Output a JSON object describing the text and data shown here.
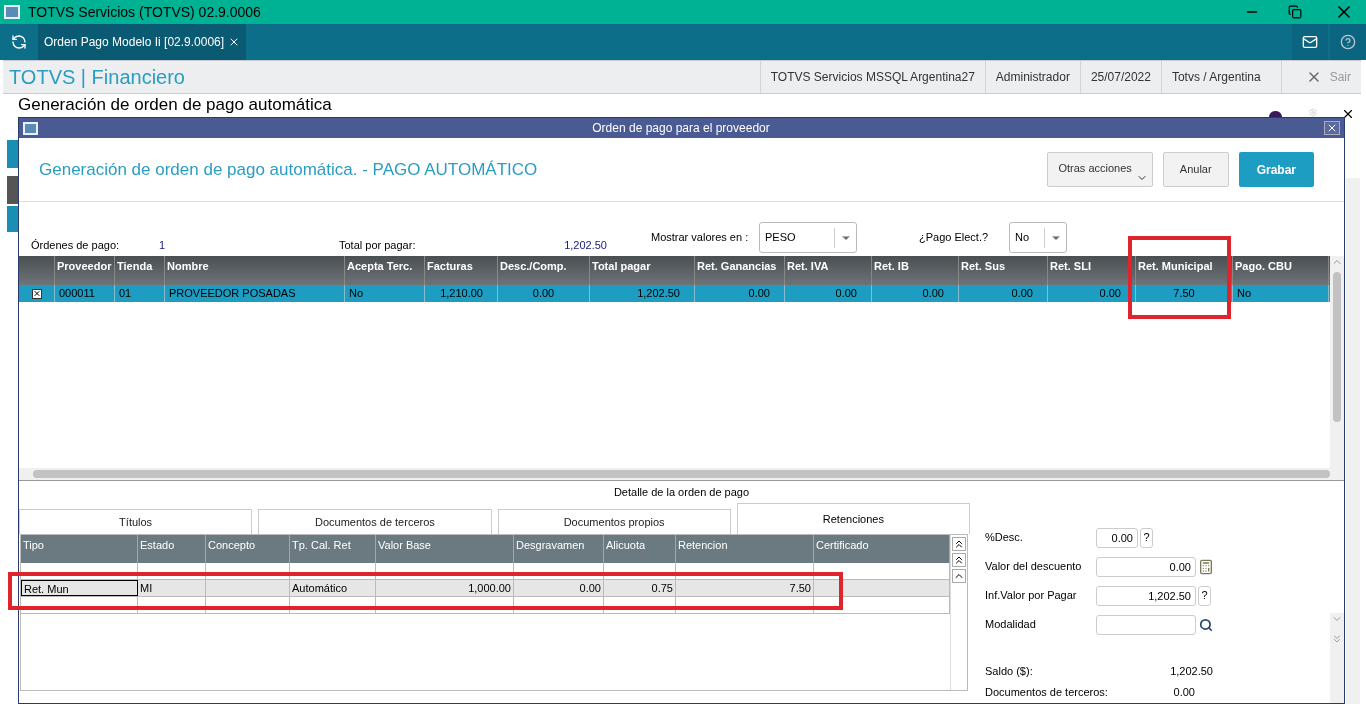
{
  "window": {
    "title": "TOTVS Servicios (TOTVS) 02.9.0006"
  },
  "app_tab": {
    "label": "Orden Pago Modelo Ii [02.9.0006]"
  },
  "header": {
    "title": "TOTVS | Financiero",
    "info": [
      "TOTVS Servicios MSSQL Argentina27",
      "Administrador",
      "25/07/2022",
      "Totvs / Argentina"
    ],
    "exit": "Sair"
  },
  "page_title": "Generación de orden de pago automática",
  "dialog": {
    "title": "Orden de pago para el proveedor",
    "heading": "Generación de orden de pago automática. - PAGO AUTOMÁTICO",
    "buttons": [
      {
        "label": "Otras acciones",
        "kind": "menu"
      },
      {
        "label": "Anular",
        "kind": "default"
      },
      {
        "label": "Grabar",
        "kind": "primary"
      }
    ],
    "summary": [
      {
        "label": "Órdenes de pago:",
        "value": "1",
        "kind": "text"
      },
      {
        "label": "Total por pagar:",
        "value": "1,202.50",
        "kind": "text"
      },
      {
        "label": "Mostrar valores en :",
        "value": "PESO",
        "kind": "select"
      },
      {
        "label": "¿Pago Elect.?",
        "value": "No",
        "kind": "select"
      }
    ],
    "grid": {
      "columns": [
        "Proveedor",
        "Tienda",
        "Nombre",
        "Acepta Terc.",
        "Facturas",
        "Desc./Comp.",
        "Total pagar",
        "Ret. Ganancias",
        "Ret. IVA",
        "Ret. IB",
        "Ret. Sus",
        "Ret. SLI",
        "Ret. Municipal",
        "Pago. CBU"
      ],
      "rows": [
        {
          "selected": true,
          "checked": true,
          "cells": [
            "000011",
            "01",
            "PROVEEDOR POSADAS",
            "No",
            "1,210.00",
            "0.00",
            "1,202.50",
            "0.00",
            "0.00",
            "0.00",
            "0.00",
            "0.00",
            "7.50",
            "No"
          ]
        }
      ]
    },
    "detail_title": "Detalle de la orden de pago",
    "detail_tabs": [
      {
        "label": "Títulos",
        "selected": false
      },
      {
        "label": "Documentos de terceros",
        "selected": false
      },
      {
        "label": "Documentos propios",
        "selected": false
      },
      {
        "label": "Retenciones",
        "selected": true
      }
    ],
    "retenciones": {
      "columns": [
        "Tipo",
        "Estado",
        "Concepto",
        "Tp. Cal. Ret",
        "Valor Base",
        "Desgravamen",
        "Alicuota",
        "Retencion",
        "Certificado"
      ],
      "rows": [
        {
          "selected": false
        },
        {
          "selected": true,
          "cells": [
            "Ret. Mun",
            "MI",
            "",
            "Automático",
            "1,000.00",
            "0.00",
            "0.75",
            "7.50",
            ""
          ]
        },
        {
          "selected": false
        }
      ]
    },
    "side_fields": [
      {
        "label": "%Desc.",
        "value": "0.00",
        "kind": "help",
        "help": "?"
      },
      {
        "label": "Valor del descuento",
        "value": "0.00",
        "kind": "calc"
      },
      {
        "label": "Inf.Valor por Pagar",
        "value": "1,202.50",
        "kind": "help",
        "help": "?"
      },
      {
        "label": "Modalidad",
        "kind": "search"
      }
    ],
    "totals": [
      {
        "label": "Saldo ($):",
        "value": "1,202.50"
      },
      {
        "label": "Documentos de terceros:",
        "value": "0.00"
      }
    ]
  }
}
